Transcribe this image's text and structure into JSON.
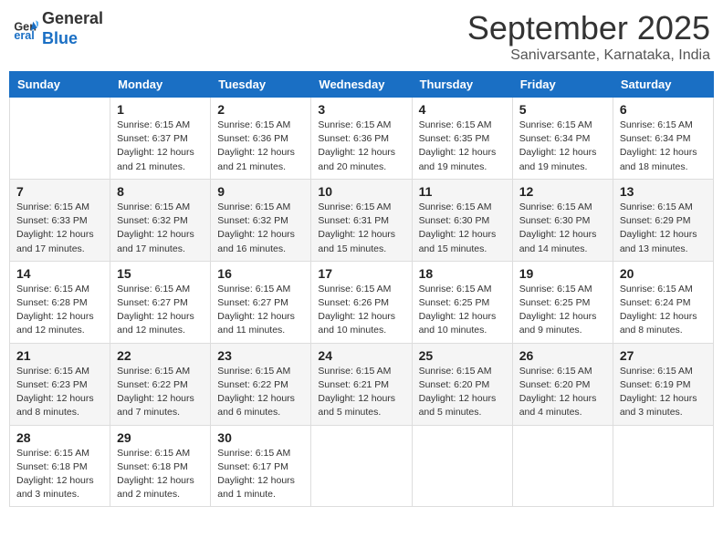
{
  "logo": {
    "line1": "General",
    "line2": "Blue"
  },
  "title": "September 2025",
  "subtitle": "Sanivarsante, Karnataka, India",
  "days_of_week": [
    "Sunday",
    "Monday",
    "Tuesday",
    "Wednesday",
    "Thursday",
    "Friday",
    "Saturday"
  ],
  "weeks": [
    [
      {
        "day": "",
        "info": ""
      },
      {
        "day": "1",
        "info": "Sunrise: 6:15 AM\nSunset: 6:37 PM\nDaylight: 12 hours\nand 21 minutes."
      },
      {
        "day": "2",
        "info": "Sunrise: 6:15 AM\nSunset: 6:36 PM\nDaylight: 12 hours\nand 21 minutes."
      },
      {
        "day": "3",
        "info": "Sunrise: 6:15 AM\nSunset: 6:36 PM\nDaylight: 12 hours\nand 20 minutes."
      },
      {
        "day": "4",
        "info": "Sunrise: 6:15 AM\nSunset: 6:35 PM\nDaylight: 12 hours\nand 19 minutes."
      },
      {
        "day": "5",
        "info": "Sunrise: 6:15 AM\nSunset: 6:34 PM\nDaylight: 12 hours\nand 19 minutes."
      },
      {
        "day": "6",
        "info": "Sunrise: 6:15 AM\nSunset: 6:34 PM\nDaylight: 12 hours\nand 18 minutes."
      }
    ],
    [
      {
        "day": "7",
        "info": "Sunrise: 6:15 AM\nSunset: 6:33 PM\nDaylight: 12 hours\nand 17 minutes."
      },
      {
        "day": "8",
        "info": "Sunrise: 6:15 AM\nSunset: 6:32 PM\nDaylight: 12 hours\nand 17 minutes."
      },
      {
        "day": "9",
        "info": "Sunrise: 6:15 AM\nSunset: 6:32 PM\nDaylight: 12 hours\nand 16 minutes."
      },
      {
        "day": "10",
        "info": "Sunrise: 6:15 AM\nSunset: 6:31 PM\nDaylight: 12 hours\nand 15 minutes."
      },
      {
        "day": "11",
        "info": "Sunrise: 6:15 AM\nSunset: 6:30 PM\nDaylight: 12 hours\nand 15 minutes."
      },
      {
        "day": "12",
        "info": "Sunrise: 6:15 AM\nSunset: 6:30 PM\nDaylight: 12 hours\nand 14 minutes."
      },
      {
        "day": "13",
        "info": "Sunrise: 6:15 AM\nSunset: 6:29 PM\nDaylight: 12 hours\nand 13 minutes."
      }
    ],
    [
      {
        "day": "14",
        "info": "Sunrise: 6:15 AM\nSunset: 6:28 PM\nDaylight: 12 hours\nand 12 minutes."
      },
      {
        "day": "15",
        "info": "Sunrise: 6:15 AM\nSunset: 6:27 PM\nDaylight: 12 hours\nand 12 minutes."
      },
      {
        "day": "16",
        "info": "Sunrise: 6:15 AM\nSunset: 6:27 PM\nDaylight: 12 hours\nand 11 minutes."
      },
      {
        "day": "17",
        "info": "Sunrise: 6:15 AM\nSunset: 6:26 PM\nDaylight: 12 hours\nand 10 minutes."
      },
      {
        "day": "18",
        "info": "Sunrise: 6:15 AM\nSunset: 6:25 PM\nDaylight: 12 hours\nand 10 minutes."
      },
      {
        "day": "19",
        "info": "Sunrise: 6:15 AM\nSunset: 6:25 PM\nDaylight: 12 hours\nand 9 minutes."
      },
      {
        "day": "20",
        "info": "Sunrise: 6:15 AM\nSunset: 6:24 PM\nDaylight: 12 hours\nand 8 minutes."
      }
    ],
    [
      {
        "day": "21",
        "info": "Sunrise: 6:15 AM\nSunset: 6:23 PM\nDaylight: 12 hours\nand 8 minutes."
      },
      {
        "day": "22",
        "info": "Sunrise: 6:15 AM\nSunset: 6:22 PM\nDaylight: 12 hours\nand 7 minutes."
      },
      {
        "day": "23",
        "info": "Sunrise: 6:15 AM\nSunset: 6:22 PM\nDaylight: 12 hours\nand 6 minutes."
      },
      {
        "day": "24",
        "info": "Sunrise: 6:15 AM\nSunset: 6:21 PM\nDaylight: 12 hours\nand 5 minutes."
      },
      {
        "day": "25",
        "info": "Sunrise: 6:15 AM\nSunset: 6:20 PM\nDaylight: 12 hours\nand 5 minutes."
      },
      {
        "day": "26",
        "info": "Sunrise: 6:15 AM\nSunset: 6:20 PM\nDaylight: 12 hours\nand 4 minutes."
      },
      {
        "day": "27",
        "info": "Sunrise: 6:15 AM\nSunset: 6:19 PM\nDaylight: 12 hours\nand 3 minutes."
      }
    ],
    [
      {
        "day": "28",
        "info": "Sunrise: 6:15 AM\nSunset: 6:18 PM\nDaylight: 12 hours\nand 3 minutes."
      },
      {
        "day": "29",
        "info": "Sunrise: 6:15 AM\nSunset: 6:18 PM\nDaylight: 12 hours\nand 2 minutes."
      },
      {
        "day": "30",
        "info": "Sunrise: 6:15 AM\nSunset: 6:17 PM\nDaylight: 12 hours\nand 1 minute."
      },
      {
        "day": "",
        "info": ""
      },
      {
        "day": "",
        "info": ""
      },
      {
        "day": "",
        "info": ""
      },
      {
        "day": "",
        "info": ""
      }
    ]
  ]
}
